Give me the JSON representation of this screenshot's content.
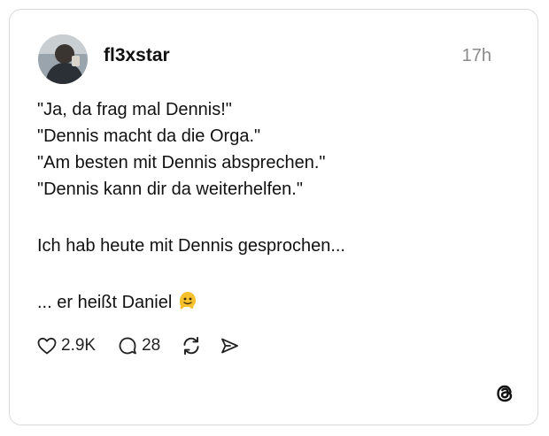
{
  "post": {
    "username": "fl3xstar",
    "time": "17h",
    "lines": [
      "\"Ja, da frag mal Dennis!\"",
      "\"Dennis macht da die Orga.\"",
      "\"Am besten mit Dennis absprechen.\"",
      "\"Dennis kann dir da weiterhelfen.\"",
      "Ich hab heute mit Dennis gesprochen...",
      "... er heißt Daniel"
    ],
    "emoji": "melting-face-emoji",
    "likes": "2.9K",
    "replies": "28"
  },
  "icons": {
    "like": "heart-icon",
    "reply": "comment-bubble-icon",
    "repost": "repost-icon",
    "share": "send-icon",
    "brand": "threads-logo-icon"
  },
  "colors": {
    "text": "#111111",
    "muted": "#8a8a8a",
    "border": "#d9d9d9",
    "emoji": "#f5c02c"
  }
}
